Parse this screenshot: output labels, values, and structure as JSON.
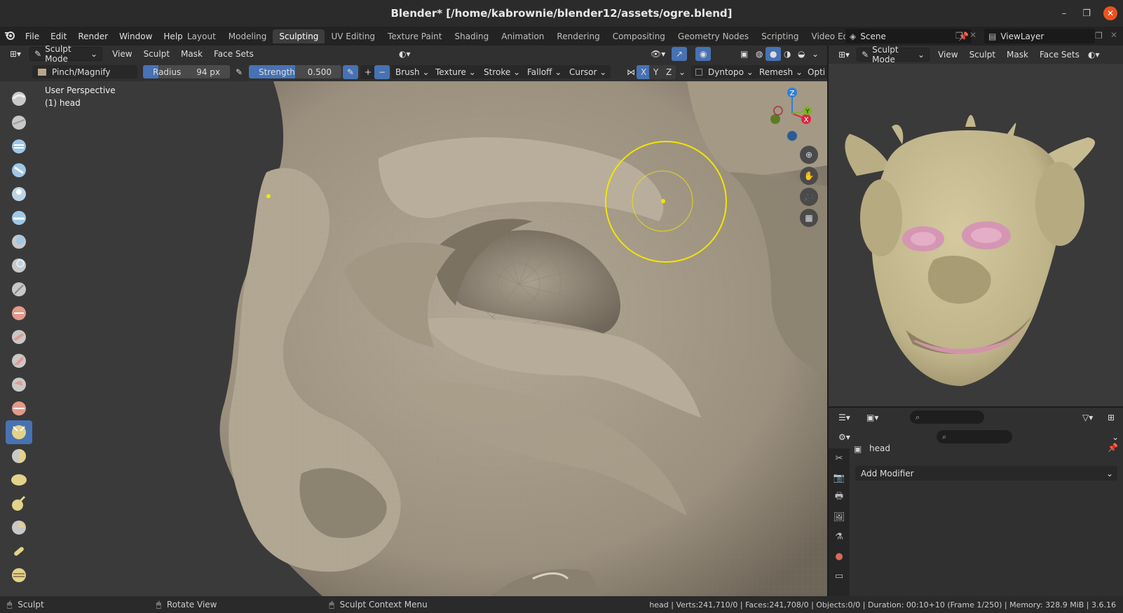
{
  "window": {
    "title": "Blender* [/home/kabrownie/blender12/assets/ogre.blend]",
    "minimize_glyph": "–",
    "maximize_glyph": "❐",
    "close_glyph": "✕"
  },
  "menu": {
    "items": [
      "File",
      "Edit",
      "Render",
      "Window",
      "Help"
    ]
  },
  "workspaces": {
    "tabs": [
      "Layout",
      "Modeling",
      "Sculpting",
      "UV Editing",
      "Texture Paint",
      "Shading",
      "Animation",
      "Rendering",
      "Compositing",
      "Geometry Nodes",
      "Scripting",
      "Video Editing"
    ],
    "active": "Sculpting",
    "add_glyph": "+"
  },
  "scene": {
    "name": "Scene",
    "view_layer": "ViewLayer"
  },
  "viewport_header": {
    "mode": "Sculpt Mode",
    "menus": [
      "View",
      "Sculpt",
      "Mask",
      "Face Sets"
    ]
  },
  "tool_settings": {
    "brush_name": "Pinch/Magnify",
    "radius_label": "Radius",
    "radius_value": "94 px",
    "strength_label": "Strength",
    "strength_value": "0.500",
    "plus": "+",
    "minus": "−",
    "dropdowns": [
      "Brush",
      "Texture",
      "Stroke",
      "Falloff",
      "Cursor"
    ],
    "axes": [
      "X",
      "Y",
      "Z"
    ],
    "dyntopo": "Dyntopo",
    "remesh": "Remesh",
    "options": "Opti"
  },
  "viewport": {
    "view_label": "User Perspective",
    "object_label": "(1) head",
    "gizmo": {
      "x": "X",
      "y": "Y",
      "z": "Z"
    }
  },
  "right_viewport": {
    "mode": "Sculpt Mode",
    "menus": [
      "View",
      "Sculpt",
      "Mask",
      "Face Sets"
    ]
  },
  "properties": {
    "object_name": "head",
    "add_modifier": "Add Modifier"
  },
  "statusbar": {
    "left_action": "Sculpt",
    "middle_action": "Rotate View",
    "right_action": "Sculpt Context Menu",
    "stats": "head | Verts:241,710/0 | Faces:241,708/0 | Objects:0/0 | Duration: 00:10+10 (Frame 1/250) | Memory: 328.9 MiB | 3.6.16"
  },
  "colors": {
    "accent": "#4772b3",
    "brush_circle": "#f2e600",
    "skin_main": "#a89d8a",
    "ogre_skin": "#c4b88f",
    "ogre_eye": "#d596b3",
    "close_button": "#e95420"
  }
}
